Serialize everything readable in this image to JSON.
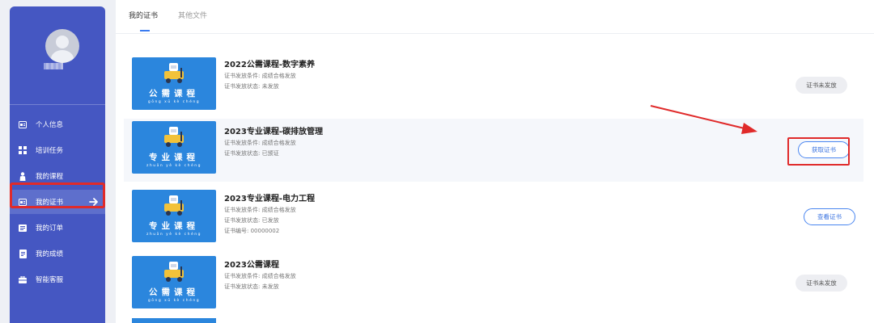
{
  "sidebar": {
    "menu": [
      {
        "label": "个人信息",
        "icon": "id-card-icon"
      },
      {
        "label": "培训任务",
        "icon": "grid-icon"
      },
      {
        "label": "我的课程",
        "icon": "person-icon"
      },
      {
        "label": "我的证书",
        "icon": "certificate-icon",
        "active": true
      },
      {
        "label": "我的订单",
        "icon": "order-icon"
      },
      {
        "label": "我的成绩",
        "icon": "document-icon"
      },
      {
        "label": "智能客服",
        "icon": "briefcase-icon"
      }
    ]
  },
  "tabs": [
    {
      "label": "我的证书",
      "active": true
    },
    {
      "label": "其他文件",
      "active": false
    }
  ],
  "certificates": [
    {
      "thumb_title": "公需课程",
      "thumb_pinyin": "gōng xū kè chéng",
      "title": "2022公需课程-数字素养",
      "lines": [
        "证书发放条件: 成绩合格发放",
        "证书发放状态: 未发放"
      ],
      "button": "证书未发放"
    },
    {
      "thumb_title": "专业课程",
      "thumb_pinyin": "zhuān yè kè chéng",
      "title": "2023专业课程-碳排放管理",
      "lines": [
        "证书发放条件: 成绩合格发放",
        "证书发放状态: 已颁证"
      ],
      "button": "获取证书"
    },
    {
      "thumb_title": "专业课程",
      "thumb_pinyin": "zhuān yè kè chéng",
      "title": "2023专业课程-电力工程",
      "lines": [
        "证书发放条件: 成绩合格发放",
        "证书发放状态: 已发放",
        "证书编号: 00000002"
      ],
      "button": "查看证书"
    },
    {
      "thumb_title": "公需课程",
      "thumb_pinyin": "gōng xū kè chéng",
      "title": "2023公需课程",
      "lines": [
        "证书发放条件: 成绩合格发放",
        "证书发放状态: 未发放"
      ],
      "button": "证书未发放"
    }
  ],
  "colors": {
    "sidebar": "#4557c2",
    "accent": "#3a7bf0",
    "annotation": "#e02a2a",
    "thumb": "#2b86dd"
  }
}
